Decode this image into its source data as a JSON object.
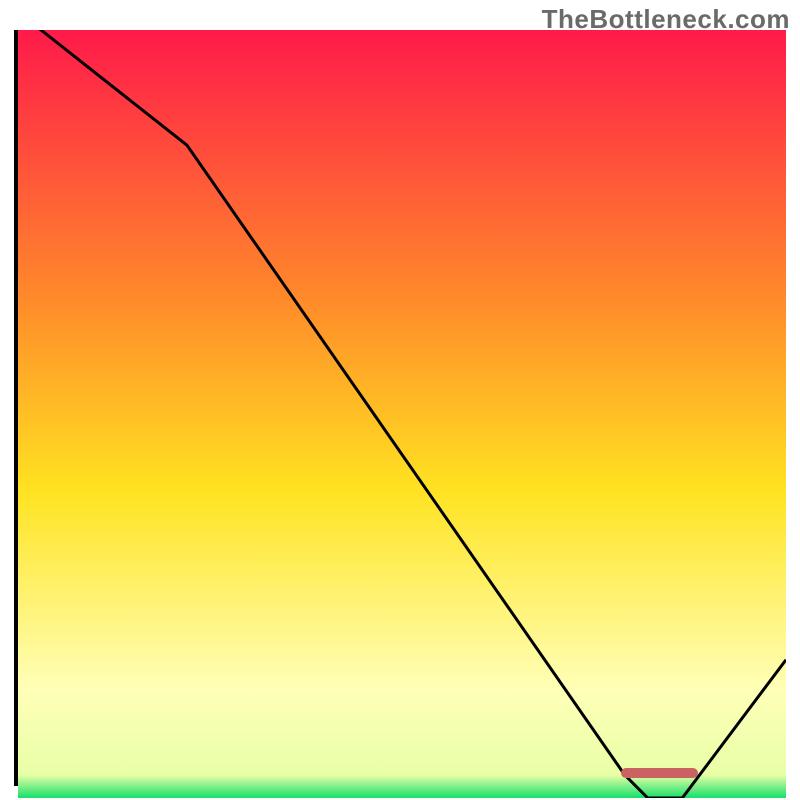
{
  "watermark": "TheBottleneck.com",
  "colors": {
    "axis": "#000000",
    "curve": "#000000",
    "marker": "#c96261",
    "grad_top": "#ff1a4a",
    "grad_mid1": "#ff8a2a",
    "grad_mid2": "#ffe321",
    "grad_pale": "#ffffb8",
    "grad_bottom": "#15e06a"
  },
  "chart_data": {
    "type": "line",
    "x": [
      0.0,
      0.03,
      0.22,
      0.79,
      0.82,
      0.865,
      1.0
    ],
    "y": [
      1.02,
      1.0,
      0.85,
      0.03,
      0.0,
      0.0,
      0.18
    ],
    "xlim": [
      0,
      1
    ],
    "ylim": [
      0,
      1
    ],
    "optimal_marker": {
      "x_start": 0.785,
      "x_end": 0.885,
      "y": 0.006
    },
    "title": "",
    "xlabel": "",
    "ylabel": "",
    "axes_visible": {
      "left": true,
      "bottom": true,
      "top": false,
      "right": false
    },
    "gradient_stops": [
      {
        "pos": 0.0,
        "color": "#ff1a4a"
      },
      {
        "pos": 0.35,
        "color": "#ff8a2a"
      },
      {
        "pos": 0.6,
        "color": "#ffe321"
      },
      {
        "pos": 0.86,
        "color": "#ffffb8"
      },
      {
        "pos": 0.97,
        "color": "#e8ffa6"
      },
      {
        "pos": 1.0,
        "color": "#15e06a"
      }
    ]
  }
}
